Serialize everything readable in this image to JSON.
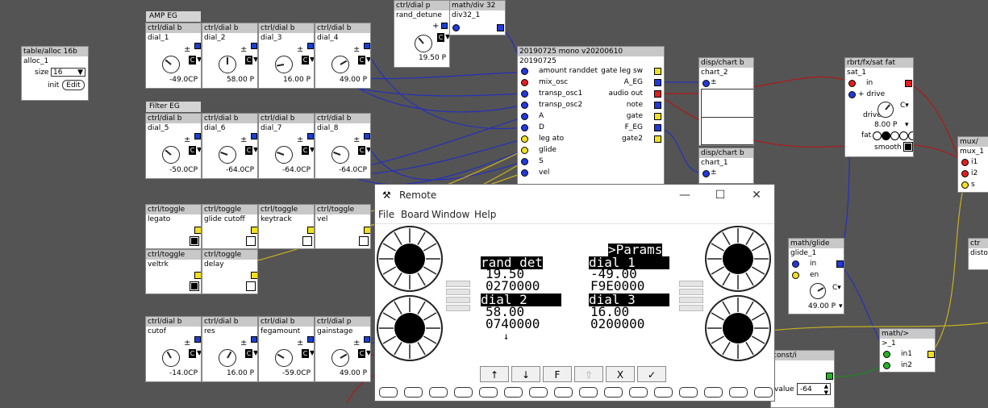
{
  "amp_eg": {
    "label": "AMP EG",
    "dials": [
      {
        "type": "ctrl/dial b",
        "name": "dial_1",
        "value": "-49.0CP",
        "angle": -50
      },
      {
        "type": "ctrl/dial b",
        "name": "dial_2",
        "value": "58.00 P",
        "angle": 0
      },
      {
        "type": "ctrl/dial b",
        "name": "dial_3",
        "value": "16.00 P",
        "angle": -100
      },
      {
        "type": "ctrl/dial b",
        "name": "dial_4",
        "value": "49.00 P",
        "angle": 60
      }
    ]
  },
  "filter_eg": {
    "label": "Filter EG",
    "dials": [
      {
        "type": "ctrl/dial b",
        "name": "dial_5",
        "value": "-50.0CP",
        "angle": -50
      },
      {
        "type": "ctrl/dial b",
        "name": "dial_6",
        "value": "-64.0CP",
        "angle": -70
      },
      {
        "type": "ctrl/dial b",
        "name": "dial_7",
        "value": "-64.0CP",
        "angle": -70
      },
      {
        "type": "ctrl/dial b",
        "name": "dial_8",
        "value": "-64.0CP",
        "angle": -70
      }
    ]
  },
  "bottom_dials": [
    {
      "type": "ctrl/dial b",
      "name": "cutof",
      "value": "-14.0CP",
      "angle": -30
    },
    {
      "type": "ctrl/dial b",
      "name": "res",
      "value": "16.00 P",
      "angle": 30
    },
    {
      "type": "ctrl/dial b",
      "name": "fegamount",
      "value": "-59.0CP",
      "angle": -60
    },
    {
      "type": "ctrl/dial p",
      "name": "gainstage",
      "value": "49.00 P",
      "angle": 60
    }
  ],
  "toggles_row1": [
    {
      "type": "ctrl/toggle",
      "name": "legato",
      "on": true
    },
    {
      "type": "ctrl/toggle",
      "name": "glide cutoff",
      "on": false
    },
    {
      "type": "ctrl/toggle",
      "name": "keytrack",
      "on": false
    },
    {
      "type": "ctrl/toggle",
      "name": "vel",
      "on": false
    }
  ],
  "toggles_row2": [
    {
      "type": "ctrl/toggle",
      "name": "veltrk",
      "on": true
    },
    {
      "type": "ctrl/toggle",
      "name": "delay",
      "on": false
    }
  ],
  "alloc": {
    "type": "table/alloc 16b",
    "name": "alloc_1",
    "size_label": "size",
    "size_value": "16",
    "init_label": "init",
    "edit_label": "Edit"
  },
  "rand_detune": {
    "type": "ctrl/dial p",
    "name": "rand_detune",
    "value": "19.50 P"
  },
  "div32": {
    "type": "math/div 32",
    "name": "div32_1"
  },
  "mono": {
    "type": "20190725 mono v20200610",
    "name": "20190725",
    "inputs": [
      "amount randdet",
      "mix_osc",
      "transp_osc1",
      "transp_osc2",
      "A",
      "D",
      "leg ato",
      "glide",
      "S",
      "vel"
    ],
    "outputs": [
      "gate leg sw",
      "A_EG",
      "audio out",
      "note",
      "gate",
      "F_EG",
      "gate2"
    ]
  },
  "chart2": {
    "type": "disp/chart b",
    "name": "chart_2"
  },
  "chart1": {
    "type": "disp/chart b",
    "name": "chart_1"
  },
  "satfat": {
    "type": "rbrt/fx/sat fat",
    "name": "sat_1",
    "in_label": "in",
    "drive_in": "+ drive",
    "drive_label": "drive",
    "drive_value": "8.00 P",
    "fat_label": "fat",
    "smooth_label": "smooth"
  },
  "mux": {
    "type": "mux/",
    "name": "mux_1",
    "ports": [
      "i1",
      "i2",
      "s"
    ]
  },
  "glide": {
    "type": "math/glide",
    "name": "glide_1",
    "in_label": "in",
    "en_label": "en",
    "value": "49.00 P"
  },
  "gt": {
    "type": "math/>",
    "name": ">_1",
    "in1": "in1",
    "in2": "in2"
  },
  "consti": {
    "type": "const/i",
    "value_label": "value",
    "value": "-64"
  },
  "right_partial": {
    "type": "ctr",
    "name": "disto"
  },
  "remote": {
    "title": "Remote",
    "menu": [
      "File",
      "Board",
      "Window",
      "Help"
    ],
    "lcd": {
      "header": ">Params",
      "left_name_1": "rand_det",
      "left_val_1": "19.50",
      "left_hex_1": "0270000",
      "right_name_1": "dial_1",
      "right_val_1": "-49.00",
      "right_hex_1": "F9E0000",
      "left_name_2": "dial_2",
      "left_val_2": "58.00",
      "left_hex_2": "0740000",
      "right_name_2": "dial_3",
      "right_val_2": "16.00",
      "right_hex_2": "0200000",
      "more": "↓"
    },
    "nav_buttons": [
      "↑",
      "↓",
      "F",
      "⇧",
      "X",
      "✓"
    ]
  }
}
